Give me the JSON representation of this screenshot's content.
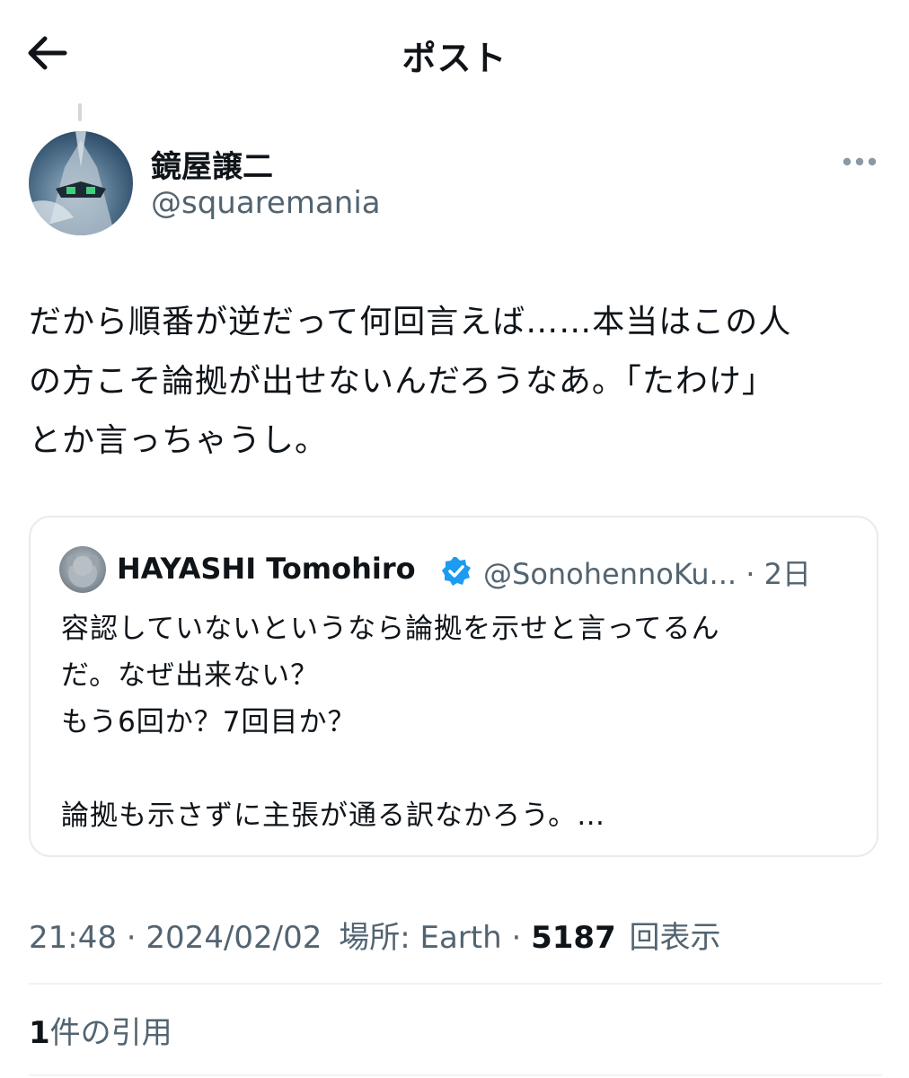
{
  "header": {
    "title": "ポスト",
    "back_icon": "arrow-left-icon"
  },
  "post": {
    "author_name": "鏡屋譲二",
    "author_handle": "@squaremania",
    "more_icon": "more-horizontal-icon",
    "text": "だから順番が逆だって何回言えば……本当はこの人\nの方こそ論拠が出せないんだろうなあ。「たわけ」\nとか言っちゃうし。",
    "quoted": {
      "name": "HAYASHI Tomohiro",
      "verified_icon": "verified-badge-icon",
      "handle_time": "@SonohennoKu... · 2日",
      "text": "容認していないというなら論拠を示せと言ってるん\nだ。なぜ出来ない？\nもう6回か？7回目か？\n\n論拠も示さずに主張が通る訳なかろう。…"
    },
    "meta": {
      "time": "21:48",
      "date": "2024/02/02",
      "location": "場所: Earth",
      "views_count": "5187",
      "views_label": "回表示"
    },
    "quotes": {
      "count": "1",
      "label": "件の引用"
    }
  },
  "colors": {
    "text": "#0f1419",
    "secondary": "#536471",
    "verified": "#1d9bf0",
    "border": "#e6ecf0"
  }
}
